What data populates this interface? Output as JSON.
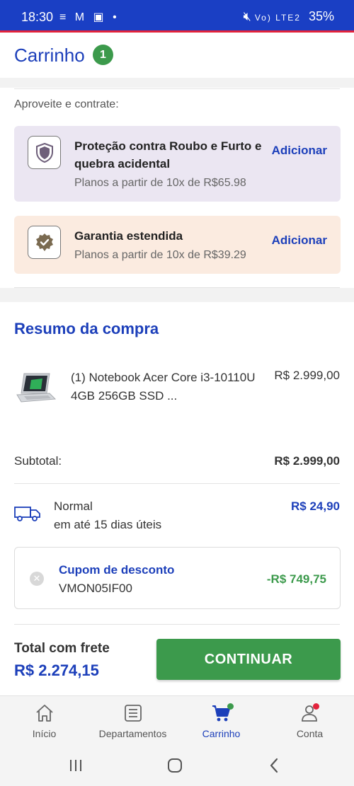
{
  "status_bar": {
    "time": "18:30",
    "notification_icons": "≡ M ▣ •",
    "signal_text": "Vo) LTE2",
    "battery": "35%"
  },
  "header": {
    "title": "Carrinho",
    "count": "1"
  },
  "offers": {
    "hint": "Aproveite e contrate:",
    "items": [
      {
        "title": "Proteção contra Roubo e Furto e quebra acidental",
        "subtitle": "Planos a partir de 10x de R$65.98",
        "action": "Adicionar",
        "icon": "shield-icon",
        "bg_color": "#ebe6f2"
      },
      {
        "title": "Garantia estendida",
        "subtitle": "Planos a partir de 10x de R$39.29",
        "action": "Adicionar",
        "icon": "badge-check-icon",
        "bg_color": "#fbebe0"
      }
    ]
  },
  "summary": {
    "title": "Resumo da compra",
    "product": {
      "name": "(1) Notebook Acer Core i3-10110U 4GB 256GB SSD ...",
      "price": "R$ 2.999,00"
    },
    "subtotal_label": "Subtotal:",
    "subtotal_value": "R$ 2.999,00",
    "shipping": {
      "name": "Normal",
      "eta": "em até 15 dias úteis",
      "price": "R$ 24,90"
    },
    "coupon": {
      "label": "Cupom de desconto",
      "code": "VMON05IF00",
      "value": "-R$ 749,75"
    },
    "total_label": "Total com frete",
    "total_value": "R$ 2.274,15",
    "continue_label": "CONTINUAR"
  },
  "bottom_nav": [
    {
      "label": "Início",
      "icon": "home-icon",
      "active": false
    },
    {
      "label": "Departamentos",
      "icon": "list-icon",
      "active": false
    },
    {
      "label": "Carrinho",
      "icon": "cart-icon",
      "active": true
    },
    {
      "label": "Conta",
      "icon": "user-icon",
      "active": false
    }
  ],
  "colors": {
    "brand_blue": "#1c3fba",
    "status_blue": "#1a3fc4",
    "accent_red": "#e2233c",
    "success_green": "#3c9a4c"
  }
}
